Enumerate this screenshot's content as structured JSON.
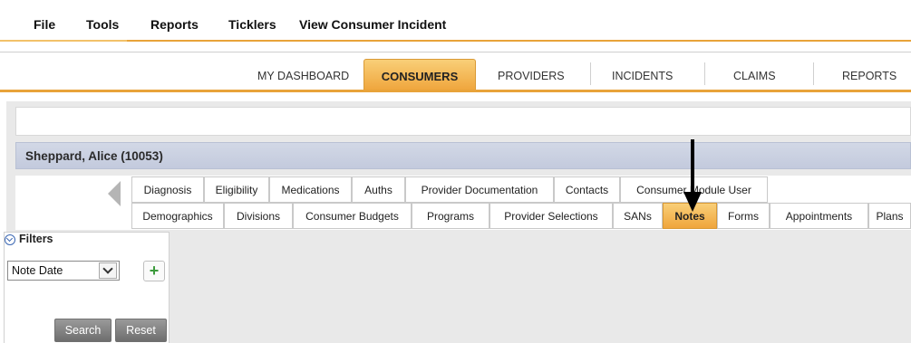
{
  "menu": [
    "File",
    "Tools",
    "Reports",
    "Ticklers",
    "View Consumer Incident"
  ],
  "nav": {
    "tabs": [
      "MY DASHBOARD",
      "CONSUMERS",
      "PROVIDERS",
      "INCIDENTS",
      "CLAIMS",
      "REPORTS"
    ],
    "active": "CONSUMERS"
  },
  "consumer": {
    "name": "Sheppard, Alice (10053)"
  },
  "tabs": {
    "row1": [
      "Diagnosis",
      "Eligibility",
      "Medications",
      "Auths",
      "Provider Documentation",
      "Contacts",
      "Consumer Module User"
    ],
    "row2": [
      "Demographics",
      "Divisions",
      "Consumer Budgets",
      "Programs",
      "Provider Selections",
      "SANs",
      "Notes",
      "Forms",
      "Appointments",
      "Plans"
    ],
    "selected": "Notes"
  },
  "filters": {
    "label": "Filters",
    "field": "Note Date",
    "add_label": "+",
    "search_label": "Search",
    "reset_label": "Reset"
  },
  "colors": {
    "accent": "#efa53c",
    "header": "#c8cfe0"
  },
  "icons": {
    "collapse": "chevron-down-circle-icon",
    "add": "plus-icon",
    "scroll": "left-triangle-icon",
    "pointer": "down-arrow-icon"
  }
}
